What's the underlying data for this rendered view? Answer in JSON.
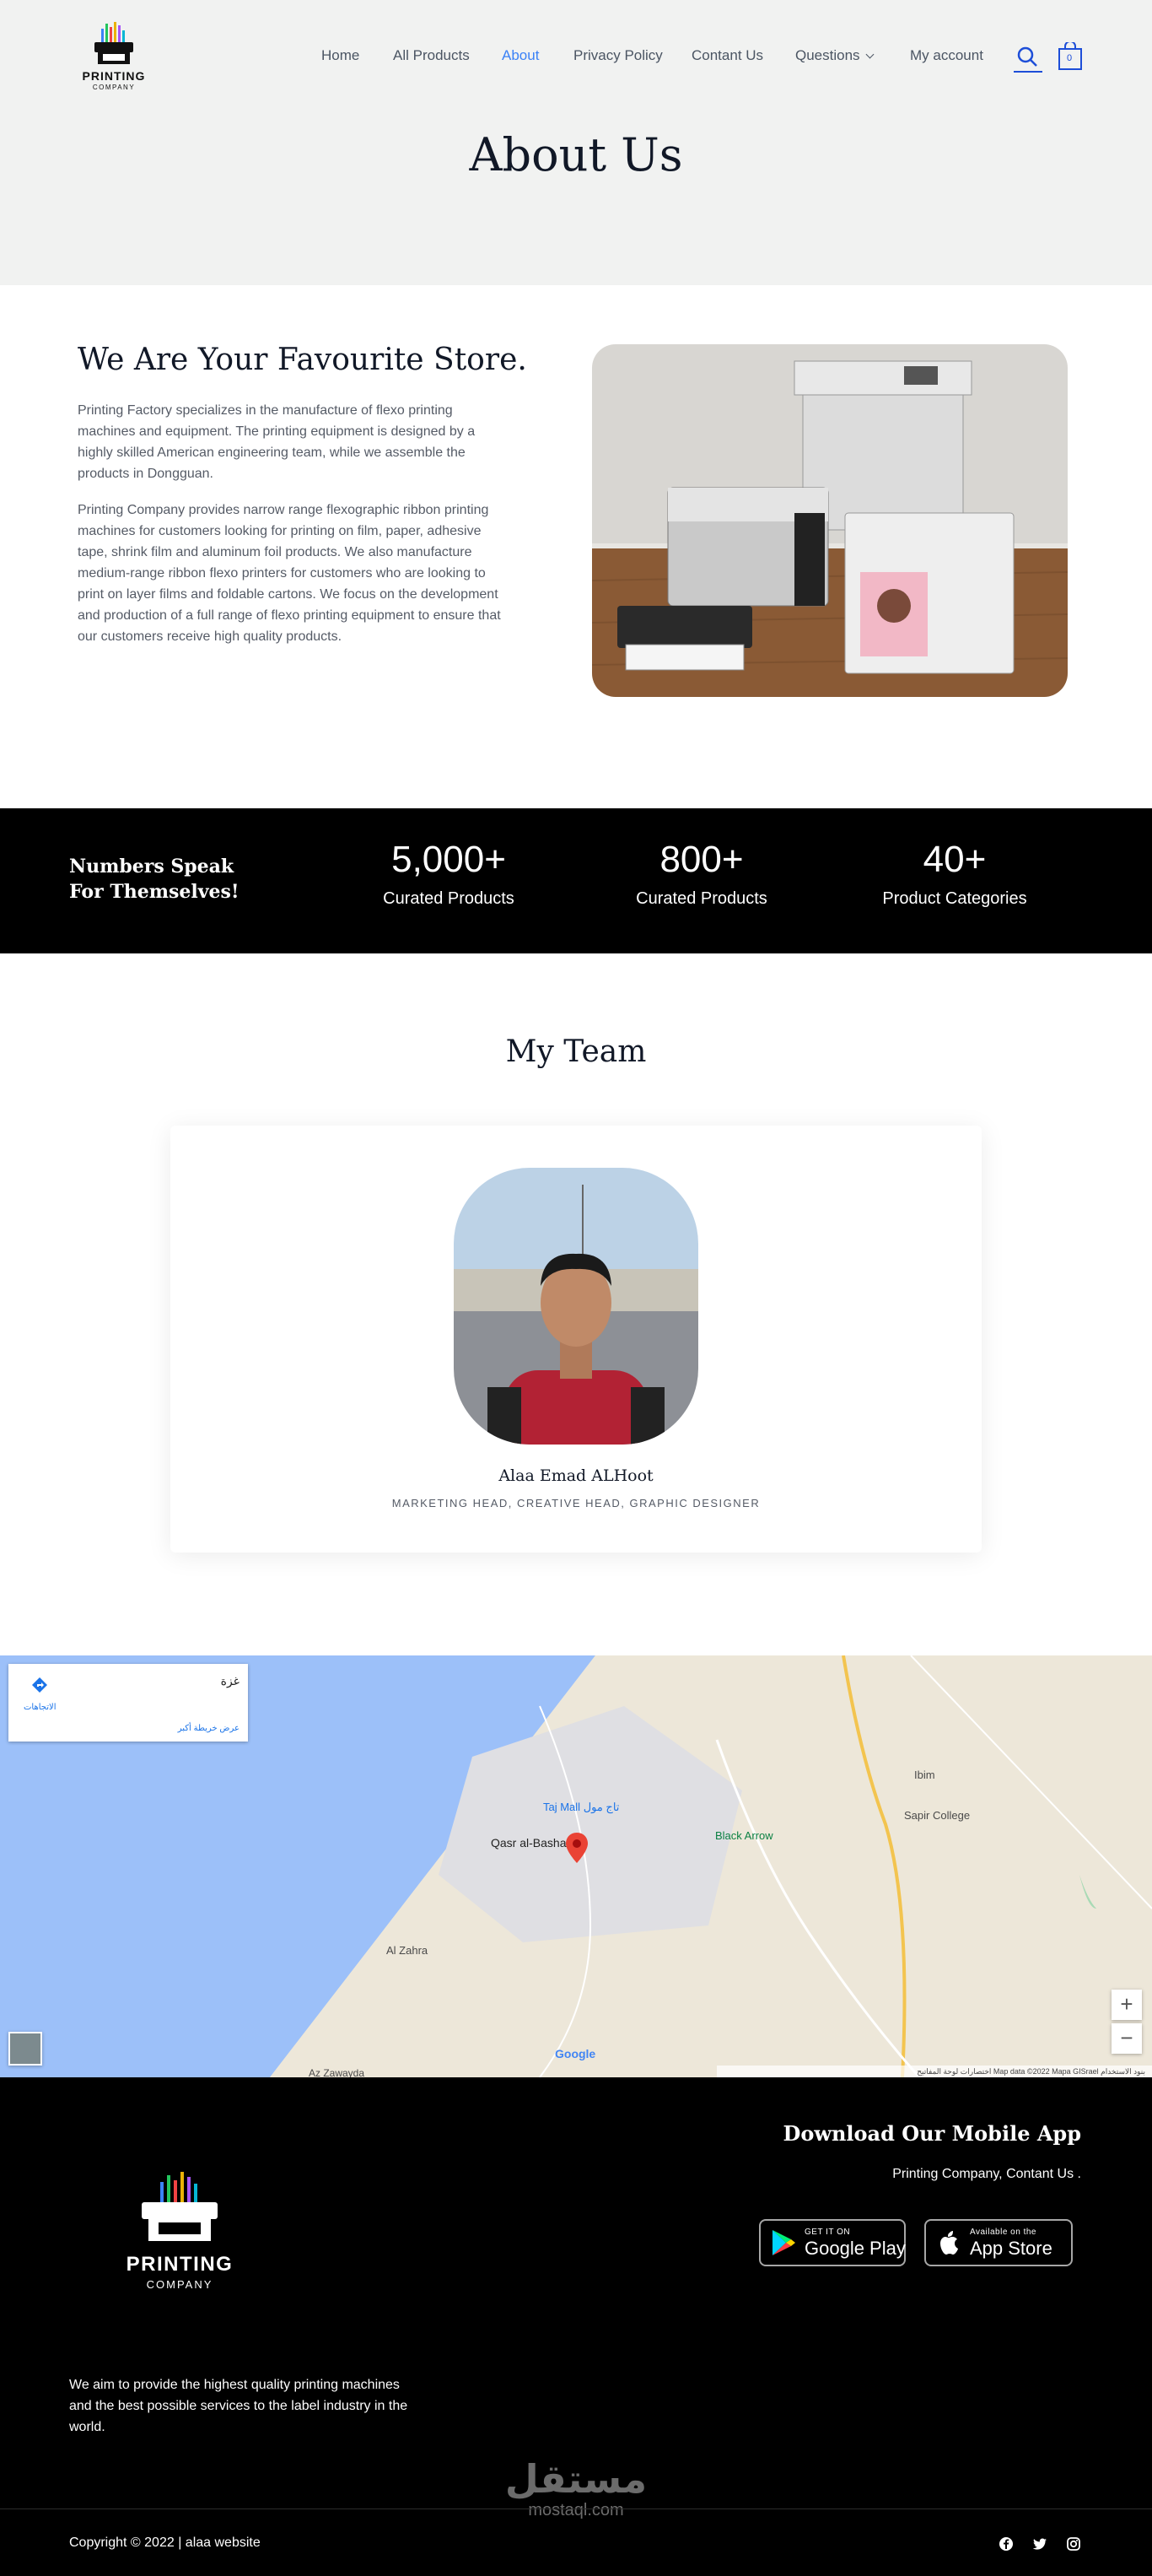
{
  "brand": {
    "logo_text": "PRINTING",
    "logo_sub": "COMPANY",
    "accent": "#3b82f6"
  },
  "nav": {
    "items": [
      {
        "label": "Home",
        "active": false
      },
      {
        "label": "All Products",
        "active": false
      },
      {
        "label": "About",
        "active": true
      },
      {
        "label": "Privacy Policy",
        "active": false
      },
      {
        "label": "Contant Us",
        "active": false
      },
      {
        "label": "Questions",
        "active": false
      },
      {
        "label": "My account",
        "active": false
      }
    ],
    "cart_count": "0",
    "search_icon": "search-icon",
    "cart_icon": "shopping-bag-icon"
  },
  "hero": {
    "title": "About Us"
  },
  "about": {
    "heading": "We Are Your Favourite Store.",
    "paragraph_1": "Printing Factory specializes in the manufacture of flexo printing machines and equipment. The printing equipment is designed by a highly skilled American engineering team, while we assemble the products in Dongguan.",
    "paragraph_2": "Printing Company provides narrow range flexographic ribbon printing machines for customers looking for printing on film, paper, adhesive tape, shrink film and aluminum foil products. We also manufacture medium-range ribbon flexo printers for customers who are looking to print on layer films and foldable cartons. We focus on the development and production of a full range of flexo printing equipment to ensure that our customers receive high quality products."
  },
  "stats": {
    "heading": "Numbers Speak For Themselves!",
    "items": [
      {
        "value": "5,000+",
        "label": "Curated Products"
      },
      {
        "value": "800+",
        "label": "Curated Products"
      },
      {
        "value": "40+",
        "label": "Product Categories"
      }
    ]
  },
  "team": {
    "heading": "My Team",
    "members": [
      {
        "name": "Alaa Emad ALHoot",
        "role": "MARKETING HEAD, CREATIVE HEAD, GRAPHIC DESIGNER"
      }
    ]
  },
  "map": {
    "place_name": "غزة",
    "directions_label": "الاتجاهات",
    "larger_map_label": "عرض خريطة أكبر",
    "labels": {
      "gaza": "Qasr al-Basha",
      "tajmall": "Taj Mall تاج مول",
      "blackarrow": "Black Arrow",
      "sapir": "Sapir College",
      "ibim": "Ibim",
      "zahra": "Al Zahra",
      "zawayda": "Az Zawayda",
      "google": "Google"
    },
    "zoom_in": "+",
    "zoom_out": "−",
    "footer_text": "اختصارات لوحة المفاتيح   Map data ©2022 Mapa GISrael   بنود الاستخدام"
  },
  "footer": {
    "app_heading": "Download Our Mobile App",
    "app_subtext": "Printing Company, Contant Us .",
    "google_play_small": "GET IT ON",
    "google_play_big": "Google Play",
    "app_store_small": "Available on the",
    "app_store_big": "App Store",
    "about_text": "We aim to provide the highest quality printing machines and the best possible services to the label industry in the world.",
    "watermark_ar": "مستقل",
    "watermark_lat": "mostaql.com",
    "copyright": "Copyright © 2022 | alaa website",
    "social_icons": [
      "facebook-icon",
      "twitter-icon",
      "instagram-icon"
    ]
  }
}
